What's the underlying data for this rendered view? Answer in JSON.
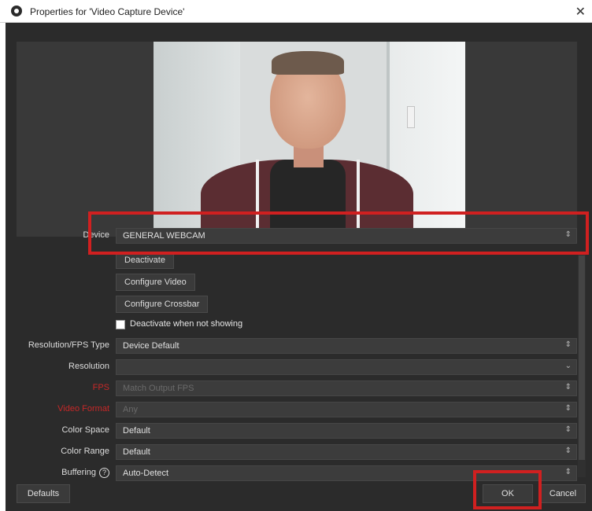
{
  "window": {
    "title": "Properties for 'Video Capture Device'",
    "close_glyph": "✕"
  },
  "form": {
    "device": {
      "label": "Device",
      "value": "GENERAL WEBCAM"
    },
    "buttons": {
      "deactivate": "Deactivate",
      "configure_video": "Configure Video",
      "configure_crossbar": "Configure Crossbar"
    },
    "deactivate_when_not_showing": {
      "label": "Deactivate when not showing",
      "checked": false
    },
    "resolution_fps_type": {
      "label": "Resolution/FPS Type",
      "value": "Device Default"
    },
    "resolution": {
      "label": "Resolution",
      "value": ""
    },
    "fps": {
      "label": "FPS",
      "value": "Match Output FPS"
    },
    "video_format": {
      "label": "Video Format",
      "value": "Any"
    },
    "color_space": {
      "label": "Color Space",
      "value": "Default"
    },
    "color_range": {
      "label": "Color Range",
      "value": "Default"
    },
    "buffering": {
      "label": "Buffering",
      "value": "Auto-Detect"
    }
  },
  "footer": {
    "defaults": "Defaults",
    "ok": "OK",
    "cancel": "Cancel"
  },
  "colors": {
    "highlight": "#d02020",
    "dialog_bg": "#2b2b2b",
    "field_bg": "#3c3c3c"
  }
}
